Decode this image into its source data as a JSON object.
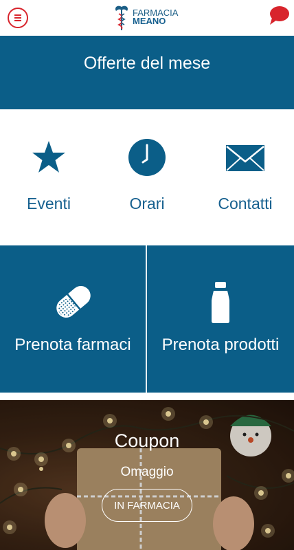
{
  "header": {
    "menu_icon": "menu-icon",
    "logo_line1": "FARMACIA",
    "logo_line2": "MEANO",
    "logo_icon": "caduceus-icon",
    "chat_icon": "chat-bubble-icon"
  },
  "offerte": {
    "label": "Offerte del mese"
  },
  "quick_links": [
    {
      "label": "Eventi",
      "icon": "star-icon"
    },
    {
      "label": "Orari",
      "icon": "clock-icon"
    },
    {
      "label": "Contatti",
      "icon": "envelope-icon"
    }
  ],
  "tiles": [
    {
      "label": "Prenota farmaci",
      "icon": "pill-icon"
    },
    {
      "label": "Prenota prodotti",
      "icon": "bottle-icon"
    }
  ],
  "coupon": {
    "title": "Coupon",
    "subtitle": "Omaggio",
    "button": "IN FARMACIA"
  },
  "colors": {
    "primary": "#0b5e88",
    "accent_red": "#d8242c",
    "text_blue": "#16608f"
  }
}
